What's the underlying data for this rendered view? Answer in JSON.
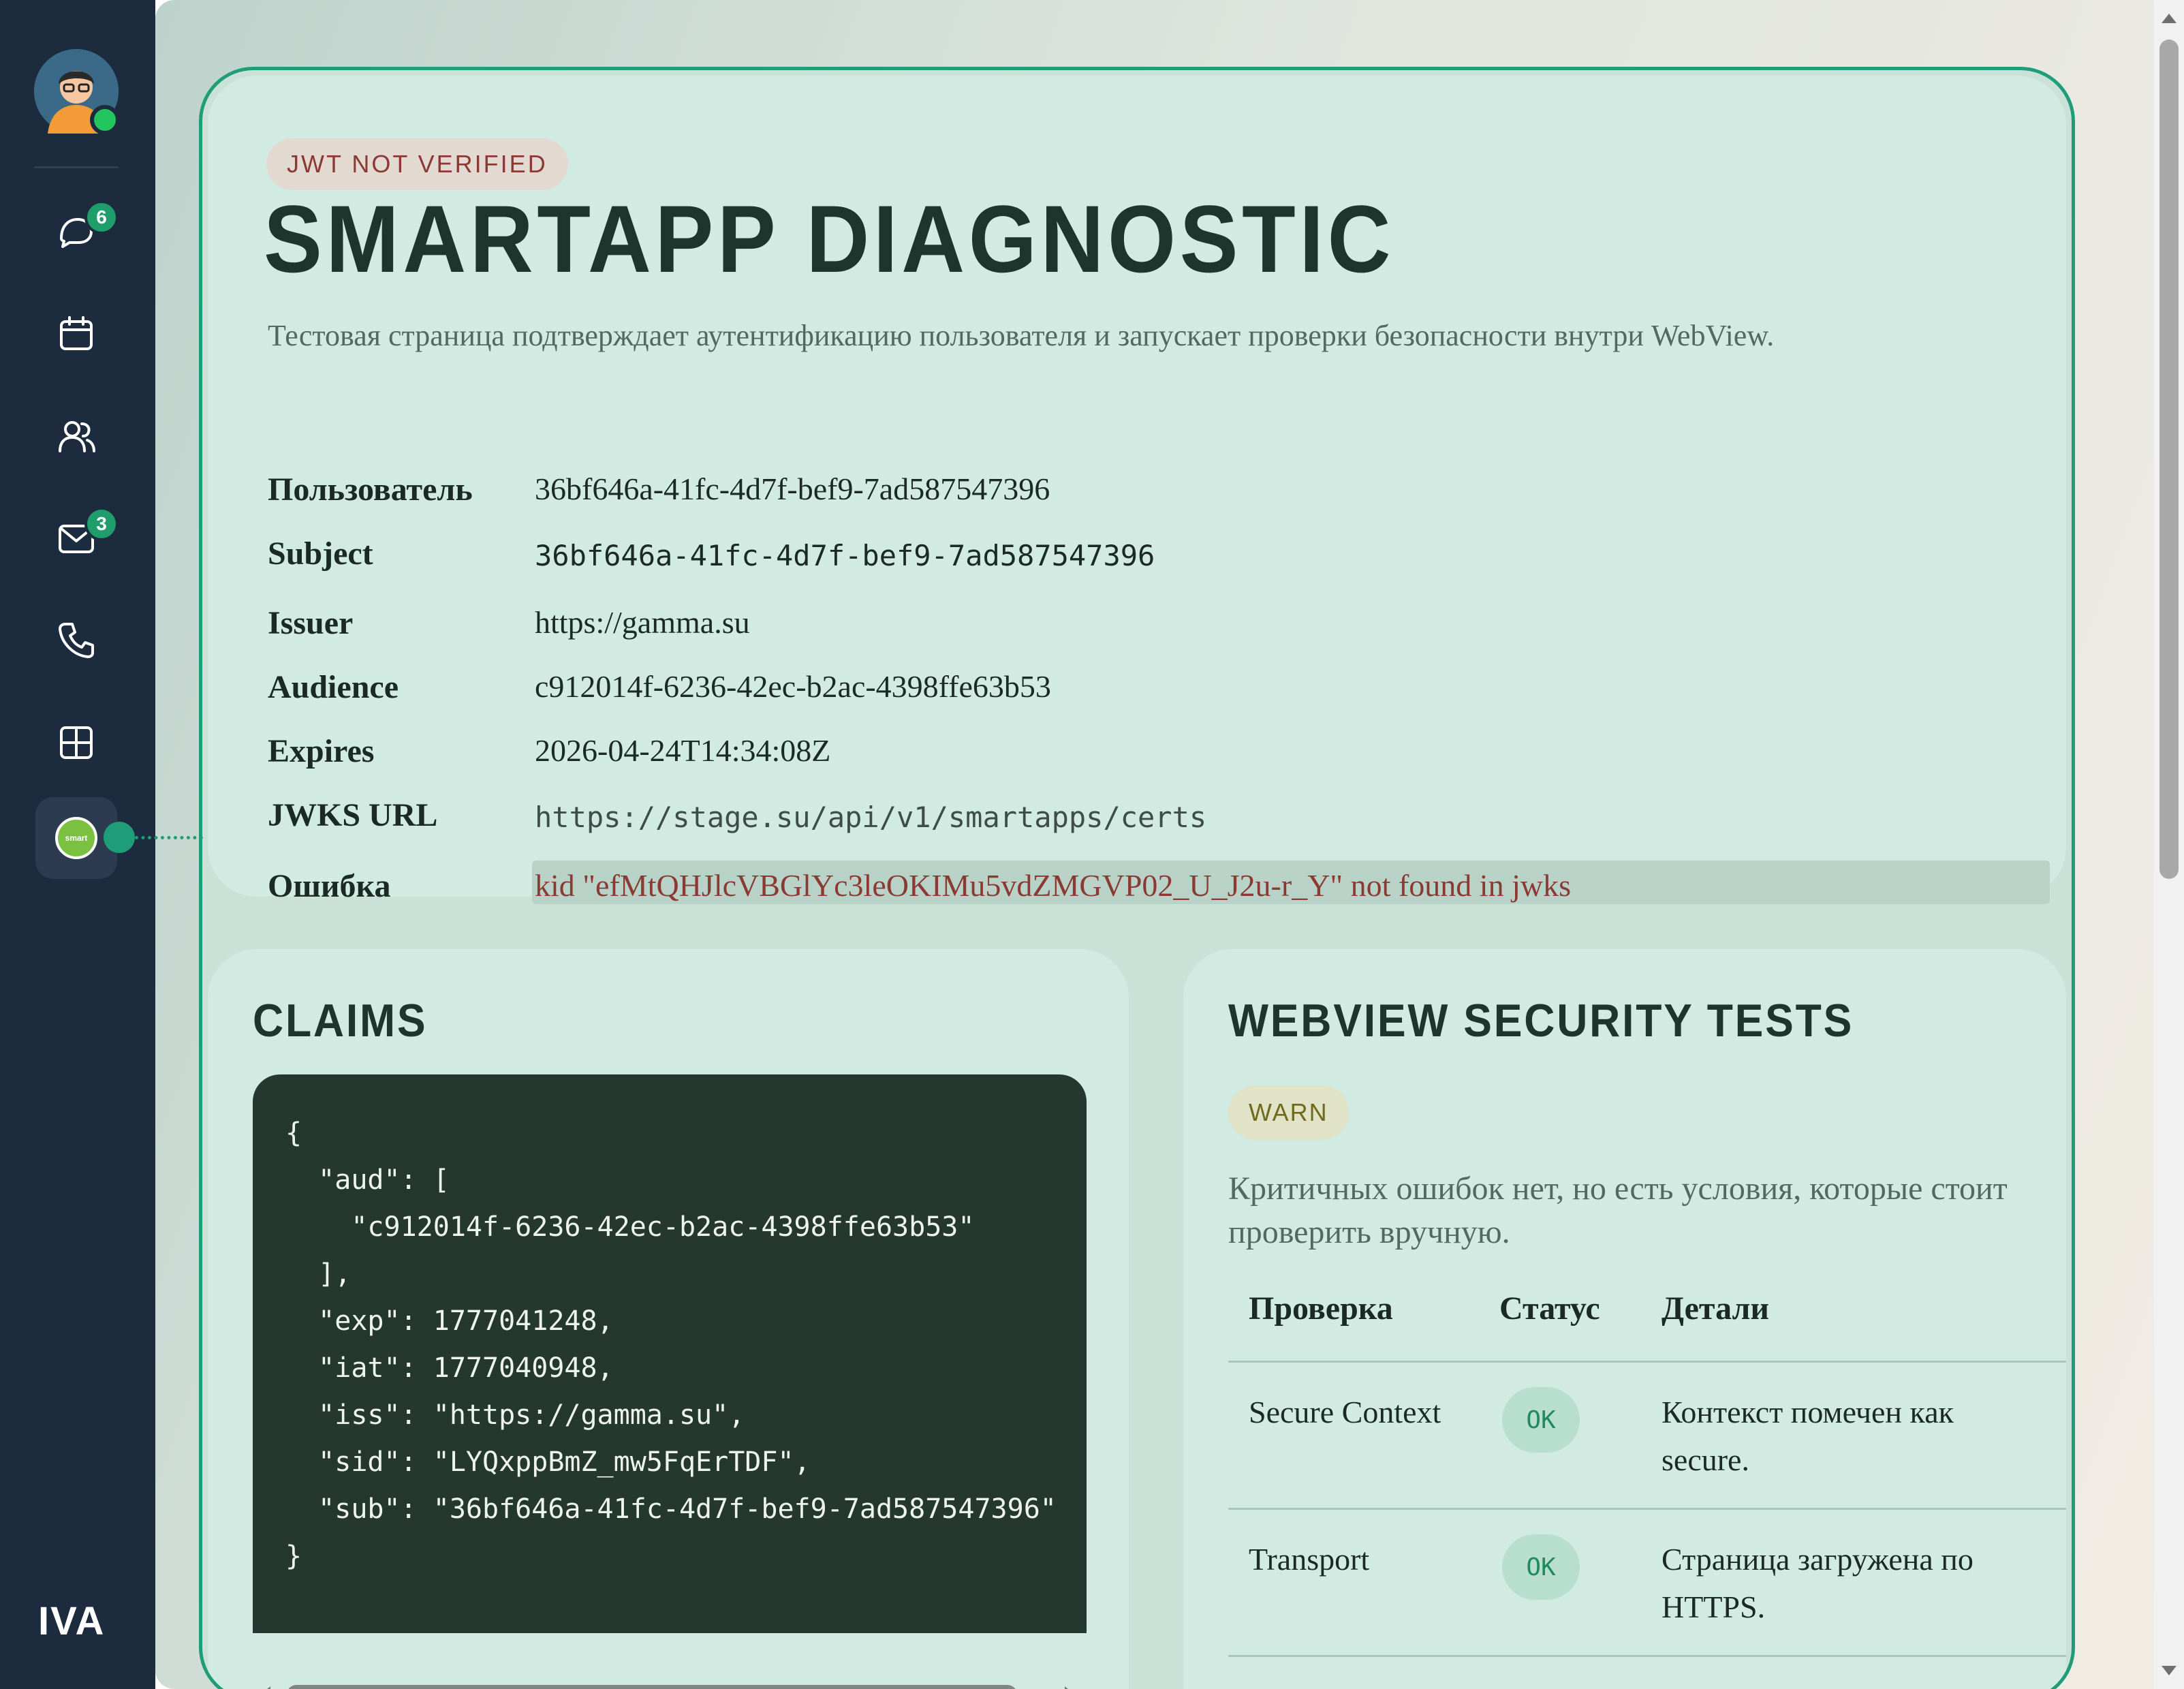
{
  "rail": {
    "nav": [
      {
        "icon": "chat-icon",
        "badge": "6"
      },
      {
        "icon": "calendar-icon",
        "badge": ""
      },
      {
        "icon": "contacts-icon",
        "badge": ""
      },
      {
        "icon": "mail-icon",
        "badge": "3"
      },
      {
        "icon": "phone-icon",
        "badge": ""
      },
      {
        "icon": "apps-grid-icon",
        "badge": ""
      },
      {
        "icon": "smartapp-icon",
        "badge": "",
        "label": "smart"
      }
    ],
    "logo": "IVA",
    "active_color": "#1f9d78"
  },
  "hero": {
    "status_pill": "JWT NOT VERIFIED",
    "title": "SMARTAPP DIAGNOSTIC",
    "description": "Тестовая страница подтверждает аутентификацию пользователя и запускает проверки безопасности внутри WebView.",
    "rows": [
      {
        "label": "Пользователь",
        "value": "36bf646a-41fc-4d7f-bef9-7ad587547396"
      },
      {
        "label": "Subject",
        "value": "36bf646a-41fc-4d7f-bef9-7ad587547396"
      },
      {
        "label": "Issuer",
        "value": "https://gamma.su"
      },
      {
        "label": "Audience",
        "value": "c912014f-6236-42ec-b2ac-4398ffe63b53"
      },
      {
        "label": "Expires",
        "value": "2026-04-24T14:34:08Z"
      },
      {
        "label": "JWKS URL",
        "value": "https://stage.su/api/v1/smartapps/certs"
      },
      {
        "label": "Ошибка",
        "value": "kid \"efMtQHJlcVBGlYc3leOKIMu5vdZMGVP02_U_J2u-r_Y\" not found in jwks"
      }
    ]
  },
  "claims": {
    "title": "CLAIMS",
    "json_text": "{\n  \"aud\": [\n    \"c912014f-6236-42ec-b2ac-4398ffe63b53\"\n  ],\n  \"exp\": 1777041248,\n  \"iat\": 1777040948,\n  \"iss\": \"https://gamma.su\",\n  \"sid\": \"LYQxppBmZ_mw5FqErTDF\",\n  \"sub\": \"36bf646a-41fc-4d7f-bef9-7ad587547396\"\n}"
  },
  "tests": {
    "title": "WEBVIEW SECURITY TESTS",
    "status_pill": "WARN",
    "description": "Критичных ошибок нет, но есть условия, которые стоит проверить вручную.",
    "columns": [
      "Проверка",
      "Статус",
      "Детали"
    ],
    "rows": [
      {
        "check": "Secure Context",
        "status": "OK",
        "details": "Контекст помечен как secure."
      },
      {
        "check": "Transport",
        "status": "OK",
        "details": "Страница загружена по HTTPS."
      }
    ]
  },
  "colors": {
    "rail_bg": "#1d2b3e",
    "accent": "#1f9d78",
    "error_text": "#8a3a32",
    "warn_text": "#6f6a1e",
    "ok_text": "#1f8a5e"
  }
}
